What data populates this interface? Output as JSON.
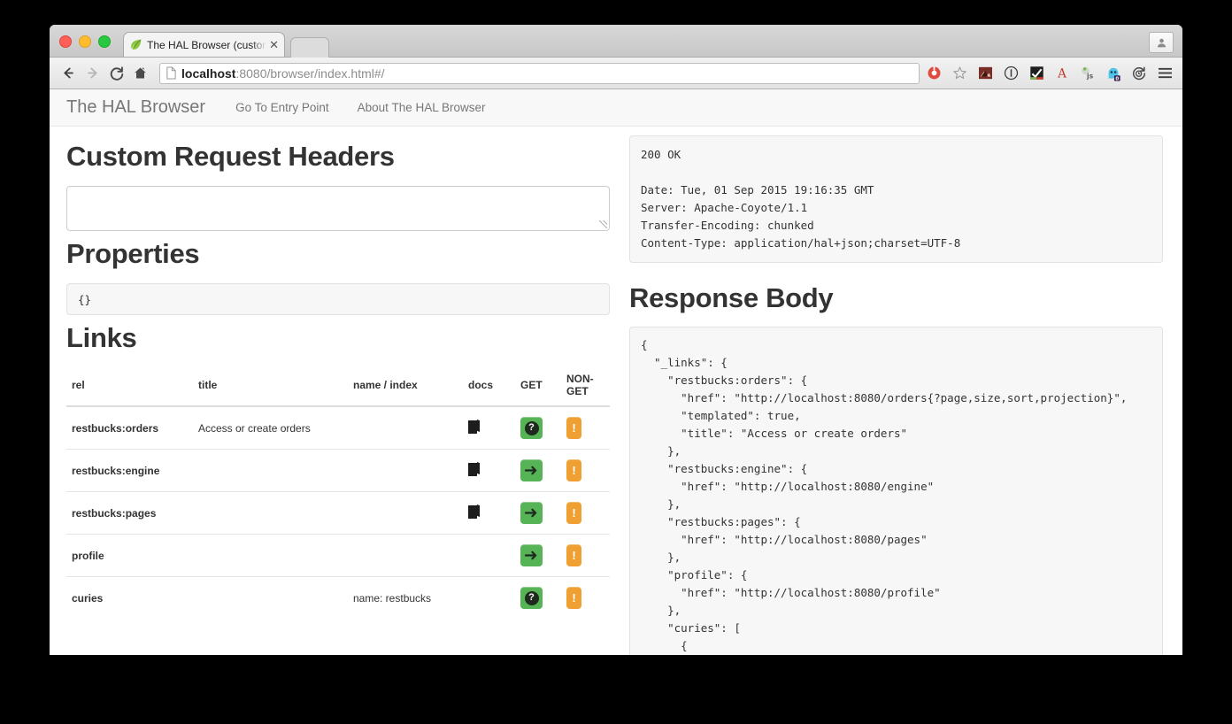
{
  "browser": {
    "tab": {
      "title": "The HAL Browser (customi",
      "close_label": "✕",
      "favicon": "spring-leaf-icon"
    },
    "url": {
      "prefix": "localhost",
      "suffix": ":8080/browser/index.html#/"
    },
    "nav": {
      "back": "back-icon",
      "forward": "forward-icon",
      "reload": "reload-icon",
      "home": "home-icon"
    },
    "extensions": [
      "adblock-icon",
      "bookmark-star-icon",
      "screenshot-icon",
      "info-icon",
      "checkmark-icon",
      "font-a-icon",
      "javascript-icon",
      "ghostery-icon",
      "history-sync-icon",
      "menu-icon"
    ],
    "profile_button": "avatar-icon"
  },
  "navbar": {
    "brand": "The HAL Browser",
    "links": [
      "Go To Entry Point",
      "About The HAL Browser"
    ]
  },
  "left": {
    "custom_headers_heading": "Custom Request Headers",
    "custom_headers_value": "",
    "custom_headers_placeholder": "",
    "properties_heading": "Properties",
    "properties_body": "{}",
    "links_heading": "Links",
    "links_table": {
      "columns": [
        "rel",
        "title",
        "name / index",
        "docs",
        "GET",
        "NON-GET"
      ],
      "rows": [
        {
          "rel": "restbucks:orders",
          "title": "Access or create orders",
          "name": "",
          "docs": true,
          "get_icon": "question-icon",
          "nonget_label": "!"
        },
        {
          "rel": "restbucks:engine",
          "title": "",
          "name": "",
          "docs": true,
          "get_icon": "arrow-right-icon",
          "nonget_label": "!"
        },
        {
          "rel": "restbucks:pages",
          "title": "",
          "name": "",
          "docs": true,
          "get_icon": "arrow-right-icon",
          "nonget_label": "!"
        },
        {
          "rel": "profile",
          "title": "",
          "name": "",
          "docs": false,
          "get_icon": "arrow-right-icon",
          "nonget_label": "!"
        },
        {
          "rel": "curies",
          "title": "",
          "name": "name: restbucks",
          "docs": false,
          "get_icon": "question-icon",
          "nonget_label": "!"
        }
      ]
    }
  },
  "right": {
    "response_headers": "200 OK\n\nDate: Tue, 01 Sep 2015 19:16:35 GMT\nServer: Apache-Coyote/1.1\nTransfer-Encoding: chunked\nContent-Type: application/hal+json;charset=UTF-8",
    "response_body_heading": "Response Body",
    "response_body": "{\n  \"_links\": {\n    \"restbucks:orders\": {\n      \"href\": \"http://localhost:8080/orders{?page,size,sort,projection}\",\n      \"templated\": true,\n      \"title\": \"Access or create orders\"\n    },\n    \"restbucks:engine\": {\n      \"href\": \"http://localhost:8080/engine\"\n    },\n    \"restbucks:pages\": {\n      \"href\": \"http://localhost:8080/pages\"\n    },\n    \"profile\": {\n      \"href\": \"http://localhost:8080/profile\"\n    },\n    \"curies\": [\n      {\n        \"href\": \"http://localhost:8080/profile/{rel}\",\n        \"name\": \"restbucks\""
  },
  "colors": {
    "get_green": "#56b356",
    "nonget_orange": "#f0a033",
    "navbar_bg": "#f8f8f8",
    "code_bg": "#f7f7f7"
  }
}
